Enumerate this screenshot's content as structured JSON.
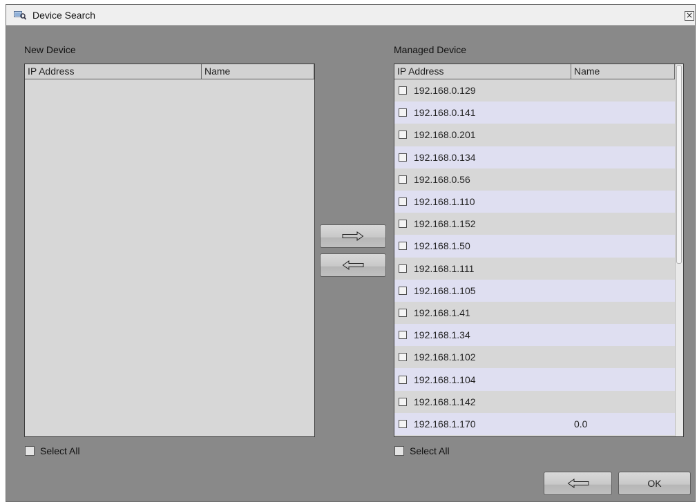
{
  "window": {
    "title": "Device Search",
    "close_glyph": "×"
  },
  "new_device": {
    "label": "New Device",
    "columns": [
      "IP Address",
      "Name"
    ],
    "rows": [],
    "select_all_label": "Select All"
  },
  "managed_device": {
    "label": "Managed Device",
    "columns": [
      "IP Address",
      "Name"
    ],
    "rows": [
      {
        "ip": "192.168.0.129",
        "name": ""
      },
      {
        "ip": "192.168.0.141",
        "name": ""
      },
      {
        "ip": "192.168.0.201",
        "name": ""
      },
      {
        "ip": "192.168.0.134",
        "name": ""
      },
      {
        "ip": "192.168.0.56",
        "name": ""
      },
      {
        "ip": "192.168.1.110",
        "name": ""
      },
      {
        "ip": "192.168.1.152",
        "name": ""
      },
      {
        "ip": "192.168.1.50",
        "name": ""
      },
      {
        "ip": "192.168.1.111",
        "name": ""
      },
      {
        "ip": "192.168.1.105",
        "name": ""
      },
      {
        "ip": "192.168.1.41",
        "name": ""
      },
      {
        "ip": "192.168.1.34",
        "name": ""
      },
      {
        "ip": "192.168.1.102",
        "name": ""
      },
      {
        "ip": "192.168.1.104",
        "name": ""
      },
      {
        "ip": "192.168.1.142",
        "name": ""
      },
      {
        "ip": "192.168.1.170",
        "name": "0.0"
      }
    ],
    "select_all_label": "Select All"
  },
  "transfer": {
    "add_icon": "arrow-right-icon",
    "remove_icon": "arrow-left-icon"
  },
  "footer": {
    "back_icon": "arrow-left-icon",
    "ok_label": "OK"
  },
  "colors": {
    "dialog_bg": "#898989",
    "row_odd": "#d7d7d7",
    "row_even": "#dfdff1"
  }
}
